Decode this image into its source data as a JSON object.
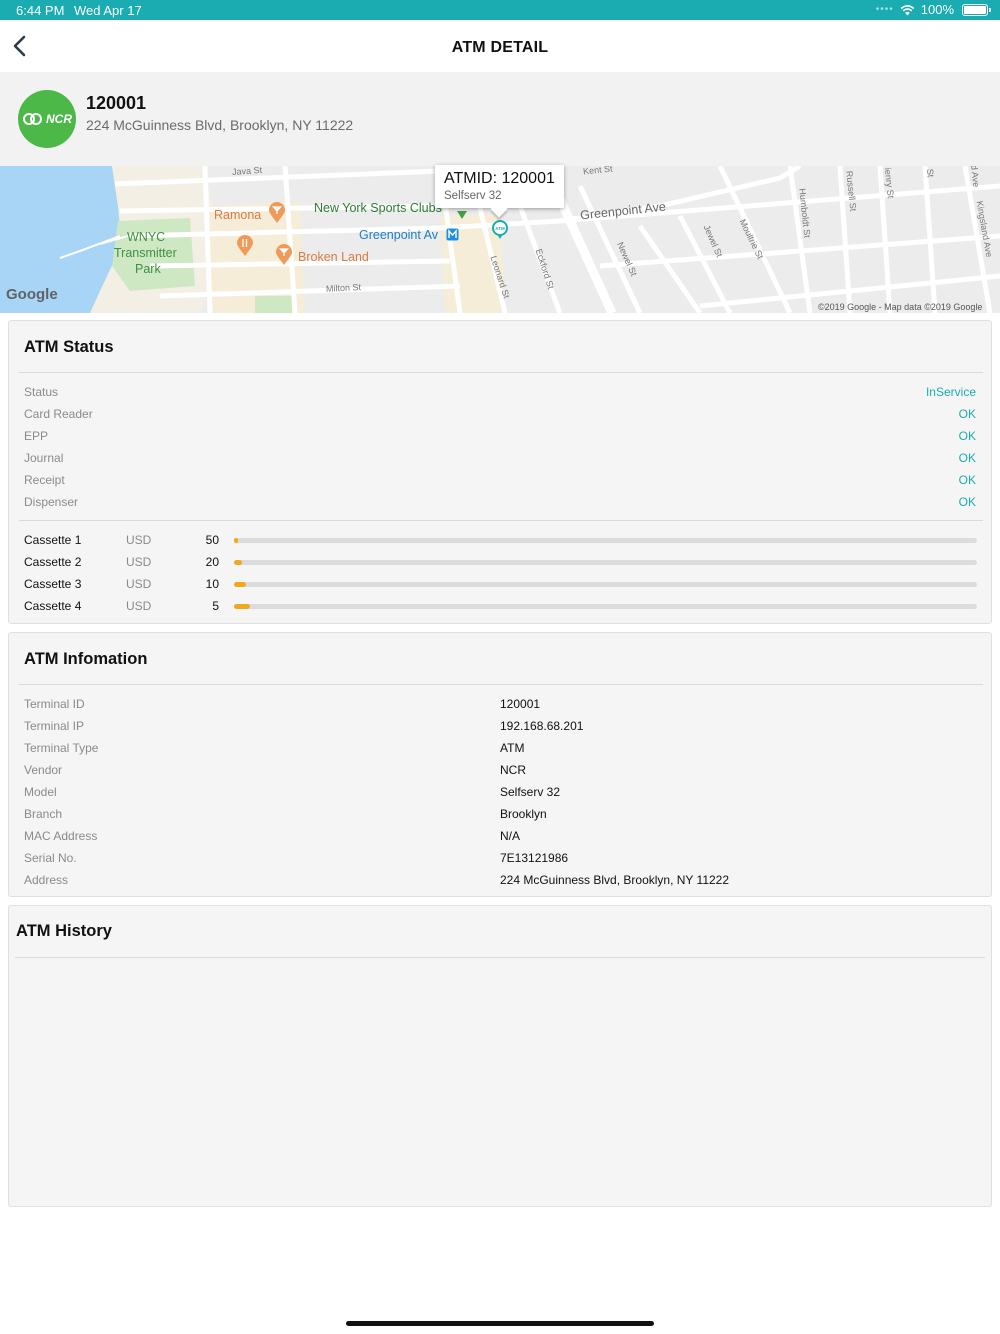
{
  "status_bar": {
    "time": "6:44 PM",
    "date": "Wed Apr 17",
    "battery": "100%",
    "icons": [
      "wifi-icon",
      "battery-icon"
    ]
  },
  "nav": {
    "title": "ATM DETAIL",
    "back_icon": "chevron-left-icon"
  },
  "atm": {
    "id": "120001",
    "address": "224 McGuinness Blvd, Brooklyn, NY 11222",
    "logo_text": "NCR"
  },
  "map": {
    "callout_title": "ATMID: 120001",
    "callout_subtitle": "Selfserv 32",
    "labels": {
      "wnyc_1": "WNYC",
      "wnyc_2": "Transmitter",
      "wnyc_3": "Park",
      "ramona": "Ramona",
      "sports_club": "New York Sports Clubs",
      "greenpoint_station": "Greenpoint Av",
      "broken_land": "Broken Land",
      "greenpoint_ave": "Greenpoint Ave",
      "java_st": "Java St",
      "kent_st": "Kent St",
      "milton_st": "Milton St",
      "leonard_st": "Leonard St",
      "eckford_st": "Eckford St",
      "newel_st": "Newel St",
      "jewel_st": "Jewel St",
      "moultrie_st": "Moultrie St",
      "humboldt_st": "Humboldt St",
      "russell_st": "Russell St",
      "henry_st": "ienry St",
      "st_fragment": "St",
      "ave_fragment": "d Ave",
      "kingsland_ave": "Kingsland Ave"
    },
    "google": "Google",
    "copyright": "©2019 Google - Map data ©2019 Google",
    "colors": {
      "water": "#a8d4f5",
      "land": "#ececec",
      "park": "#cfe8c4",
      "road": "#ffffff"
    }
  },
  "status_section": {
    "title": "ATM Status",
    "rows": [
      {
        "label": "Status",
        "value": "InService"
      },
      {
        "label": "Card Reader",
        "value": "OK"
      },
      {
        "label": "EPP",
        "value": "OK"
      },
      {
        "label": "Journal",
        "value": "OK"
      },
      {
        "label": "Receipt",
        "value": "OK"
      },
      {
        "label": "Dispenser",
        "value": "OK"
      }
    ],
    "cassettes": [
      {
        "name": "Cassette 1",
        "currency": "USD",
        "count": "50",
        "fill_fraction": 0.004
      },
      {
        "name": "Cassette 2",
        "currency": "USD",
        "count": "20",
        "fill_fraction": 0.011
      },
      {
        "name": "Cassette 3",
        "currency": "USD",
        "count": "10",
        "fill_fraction": 0.016
      },
      {
        "name": "Cassette 4",
        "currency": "USD",
        "count": "5",
        "fill_fraction": 0.021
      }
    ],
    "accent_color": "#1aacb0",
    "bar_color": "#f2a81d"
  },
  "info_section": {
    "title": "ATM Infomation",
    "rows": [
      {
        "label": "Terminal ID",
        "value": "120001"
      },
      {
        "label": "Terminal IP",
        "value": "192.168.68.201"
      },
      {
        "label": "Terminal Type",
        "value": "ATM"
      },
      {
        "label": "Vendor",
        "value": "NCR"
      },
      {
        "label": "Model",
        "value": "Selfserv 32"
      },
      {
        "label": "Branch",
        "value": "Brooklyn"
      },
      {
        "label": "MAC Address",
        "value": "N/A"
      },
      {
        "label": "Serial No.",
        "value": "7E13121986"
      },
      {
        "label": "Address",
        "value": "224 McGuinness Blvd, Brooklyn, NY 11222"
      }
    ]
  },
  "history_section": {
    "title": "ATM History"
  }
}
